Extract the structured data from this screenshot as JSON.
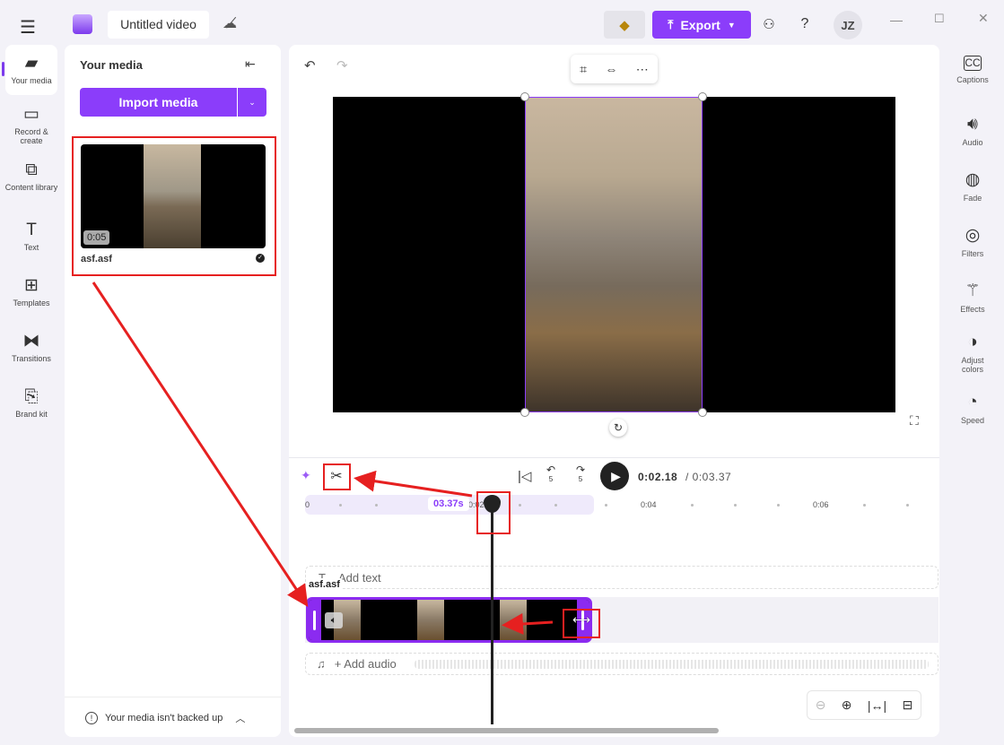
{
  "header": {
    "title": "Untitled video",
    "export_label": "Export",
    "avatar": "JZ",
    "help": "?"
  },
  "left_rail": [
    {
      "label": "Your media",
      "icon": "folder-icon"
    },
    {
      "label": "Record & create",
      "icon": "camera-icon"
    },
    {
      "label": "Content library",
      "icon": "library-icon"
    },
    {
      "label": "Text",
      "icon": "text-icon"
    },
    {
      "label": "Templates",
      "icon": "templates-icon"
    },
    {
      "label": "Transitions",
      "icon": "transitions-icon"
    },
    {
      "label": "Brand kit",
      "icon": "brand-kit-icon"
    }
  ],
  "media_panel": {
    "title": "Your media",
    "import_label": "Import media",
    "items": [
      {
        "name": "asf.asf",
        "duration": "0:05"
      }
    ],
    "backup_notice": "Your media isn't backed up"
  },
  "right_rail": [
    {
      "label": "Captions"
    },
    {
      "label": "Audio"
    },
    {
      "label": "Fade"
    },
    {
      "label": "Filters"
    },
    {
      "label": "Effects"
    },
    {
      "label": "Adjust colors"
    },
    {
      "label": "Speed"
    }
  ],
  "playback": {
    "current": "0:02.18",
    "total": "/ 0:03.37",
    "skip": "5"
  },
  "timeline": {
    "ticks": [
      "0",
      "0:02",
      "0:04",
      "0:06"
    ],
    "selection_duration": "03.37s",
    "add_text": "Add text",
    "add_audio": "+ Add audio",
    "clip_name": "asf.asf"
  },
  "colors": {
    "accent": "#7c3aed",
    "annotation": "#e62020"
  }
}
